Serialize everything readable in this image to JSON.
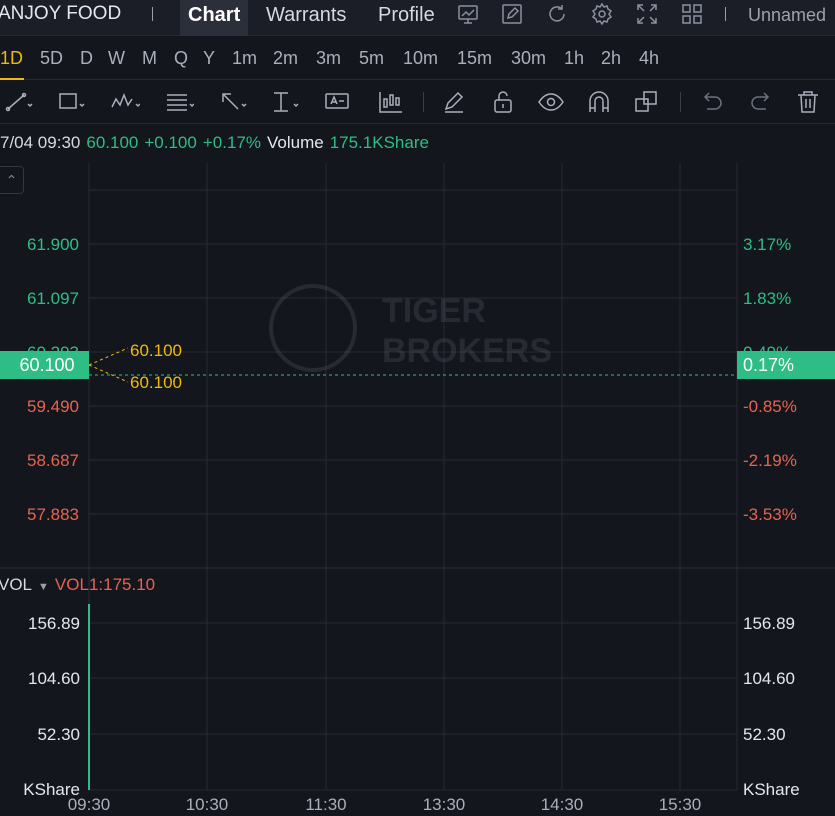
{
  "header": {
    "stock_name": "ANJOY FOOD",
    "tabs": [
      {
        "label": "Chart",
        "active": true
      },
      {
        "label": "Warrants",
        "active": false
      },
      {
        "label": "Profile",
        "active": false
      }
    ],
    "toolbar_icons": [
      "chart-trend-icon",
      "pencil-edit-icon",
      "refresh-icon",
      "gear-icon",
      "fullscreen-icon",
      "grid-layout-icon"
    ],
    "layout_name": "Unnamed"
  },
  "periods": {
    "items": [
      "1D",
      "5D",
      "D",
      "W",
      "M",
      "Q",
      "Y",
      "1m",
      "2m",
      "3m",
      "5m",
      "10m",
      "15m",
      "30m",
      "1h",
      "2h",
      "4h"
    ],
    "active": "1D"
  },
  "drawing_tools": [
    "trend-line-icon",
    "rectangle-icon",
    "pattern-icon",
    "fibonacci-icon",
    "arrow-icon",
    "measure-icon",
    "text-note-icon",
    "bar-pattern-icon",
    "pencil-icon",
    "lock-icon",
    "eye-icon",
    "magnet-icon",
    "clone-icon",
    "undo-icon",
    "redo-icon",
    "trash-icon"
  ],
  "quote": {
    "time": "7/04 09:30",
    "price": "60.100",
    "change": "+0.100",
    "change_pct": "+0.17%",
    "volume_label": "Volume",
    "volume_value": "175.1KShare"
  },
  "colors": {
    "up": "#2ebd85",
    "down": "#e8634e",
    "highlight": "#f0b90b",
    "background": "#14161d",
    "grid": "#262a35"
  },
  "chart_data": [
    {
      "type": "line",
      "pane": "price",
      "y_ticks_left": [
        "61.900",
        "61.097",
        "60.293",
        "59.490",
        "58.687",
        "57.883"
      ],
      "y_ticks_right": [
        "3.17%",
        "1.83%",
        "0.49%",
        "-0.85%",
        "-2.19%",
        "-3.53%"
      ],
      "ylim": [
        57.4,
        62.4
      ],
      "x_ticks": [
        "09:30",
        "10:30",
        "11:30",
        "13:30",
        "14:30",
        "15:30"
      ],
      "series": [
        {
          "x": [
            "09:30"
          ],
          "values": [
            60.1
          ]
        }
      ],
      "current_price_label": "60.100",
      "current_pct_label": "0.17%",
      "annotations": [
        "60.100",
        "60.100"
      ],
      "watermark": "TIGER BROKERS"
    },
    {
      "type": "bar",
      "pane": "volume",
      "indicator_name": "VOL",
      "indicator_value": "VOL1:175.10",
      "y_ticks": [
        "156.89",
        "104.60",
        "52.30"
      ],
      "unit": "KShare",
      "ylim": [
        0,
        175.1
      ],
      "categories": [
        "09:30"
      ],
      "values": [
        175.1
      ]
    }
  ]
}
